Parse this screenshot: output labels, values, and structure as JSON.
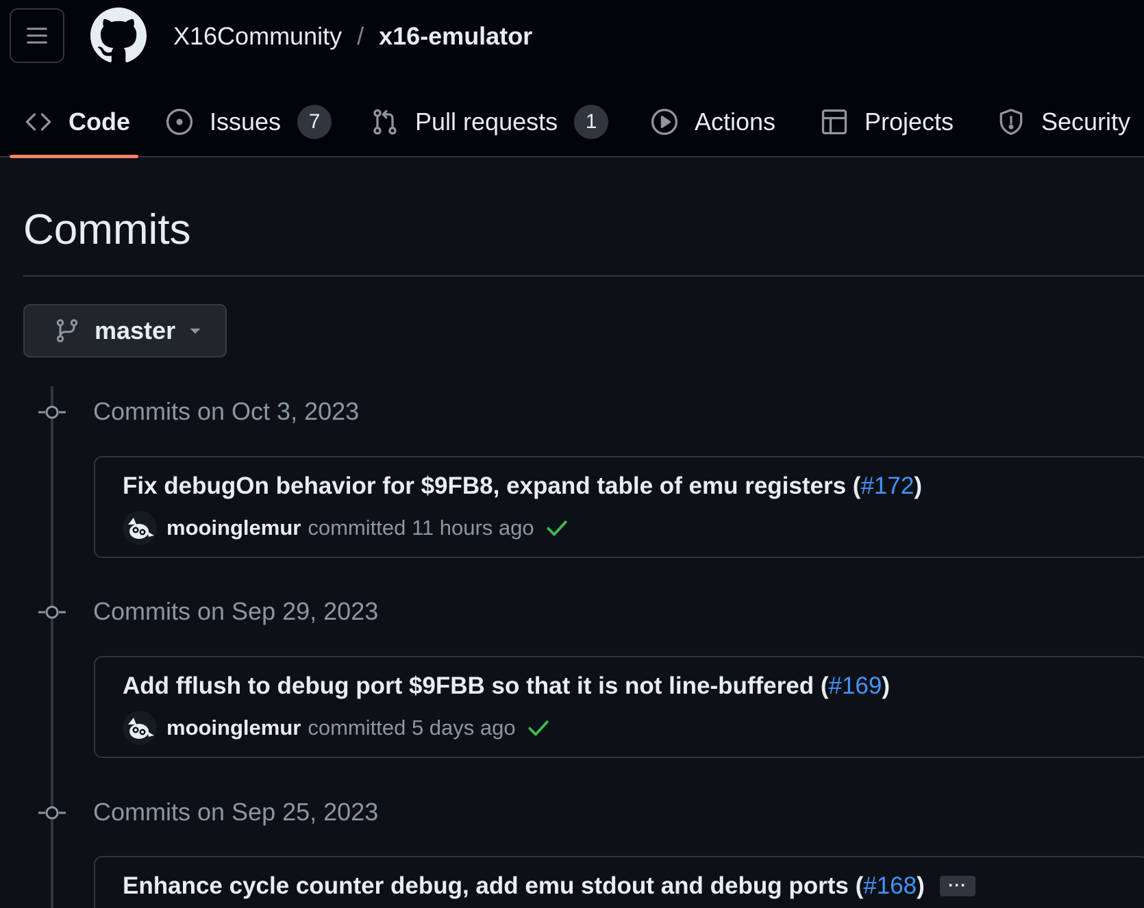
{
  "header": {
    "owner": "X16Community",
    "separator": "/",
    "repo": "x16-emulator",
    "menu_icon": "hamburger-icon",
    "logo_icon": "github-logo-icon"
  },
  "tabs": [
    {
      "label": "Code",
      "icon": "code-icon",
      "active": true
    },
    {
      "label": "Issues",
      "icon": "issue-opened-icon",
      "count": "7"
    },
    {
      "label": "Pull requests",
      "icon": "git-pull-request-icon",
      "count": "1"
    },
    {
      "label": "Actions",
      "icon": "play-icon"
    },
    {
      "label": "Projects",
      "icon": "table-icon"
    },
    {
      "label": "Security",
      "icon": "shield-icon"
    }
  ],
  "page": {
    "title": "Commits",
    "branch": "master"
  },
  "groups": [
    {
      "title": "Commits on Oct 3, 2023",
      "commit": {
        "message": "Fix debugOn behavior for $9FB8, expand table of emu registers (",
        "pr": "#172",
        "close": ")",
        "author": "mooinglemur",
        "action": "committed 11 hours ago",
        "status": "success"
      }
    },
    {
      "title": "Commits on Sep 29, 2023",
      "commit": {
        "message": "Add fflush to debug port $9FBB so that it is not line-buffered (",
        "pr": "#169",
        "close": ")",
        "author": "mooinglemur",
        "action": "committed 5 days ago",
        "status": "success"
      }
    },
    {
      "title": "Commits on Sep 25, 2023",
      "commit": {
        "message": "Enhance cycle counter debug, add emu stdout and debug ports (",
        "pr": "#168",
        "close": ")",
        "ellipsis": "···"
      }
    }
  ],
  "colors": {
    "background": "#0d1117",
    "header_bg": "#010409",
    "accent_underline": "#f78166",
    "link": "#4493f8",
    "success": "#3fb950"
  }
}
